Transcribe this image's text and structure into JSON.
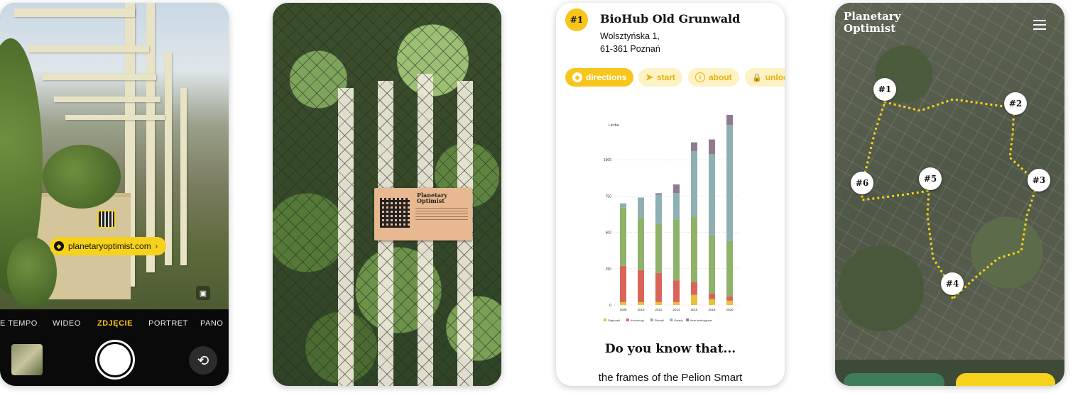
{
  "camera": {
    "modes": [
      "TIME-LAPSE TEMPO",
      "WIDEO",
      "ZDJĘCIE",
      "PORTRET",
      "PANORAMA"
    ],
    "modes_visible": [
      "E TEMPO",
      "WIDEO",
      "ZDJĘCIE",
      "PORTRET",
      "PANO"
    ],
    "active_mode": "ZDJĘCIE",
    "link_chip": "planetaryoptimist.com",
    "accent": "#f7c51c"
  },
  "sign": {
    "logo_line1": "Planetary",
    "logo_line2": "Optimist"
  },
  "detail": {
    "badge": "#1",
    "title": "BioHub Old Grunwald",
    "address_line1": "Wolsztyńska 1,",
    "address_line2": "61-361 Poznań",
    "actions": [
      {
        "label": "directions",
        "icon": "diamond-arrow-icon"
      },
      {
        "label": "start",
        "icon": "navigation-arrow-icon"
      },
      {
        "label": "about",
        "icon": "info-icon"
      },
      {
        "label": "unlock",
        "icon": "lock-icon"
      }
    ],
    "section_title": "Do you know that...",
    "body_text": "the frames of the Pelion Smart"
  },
  "chart_data": {
    "type": "bar",
    "stacked": true,
    "ylabel": "Liczba",
    "ylim": [
      0,
      1250
    ],
    "yticks": [
      0,
      250,
      500,
      750,
      1000
    ],
    "categories": [
      "2008",
      "2010",
      "2012",
      "2014",
      "2016",
      "2018",
      "2020"
    ],
    "series": [
      {
        "name": "Pajęczaki",
        "color": "#e6c13a",
        "values": [
          20,
          20,
          20,
          20,
          70,
          40,
          30
        ]
      },
      {
        "name": "Krocionogi",
        "color": "#d9655a",
        "values": [
          250,
          220,
          200,
          150,
          90,
          40,
          30
        ]
      },
      {
        "name": "Ślimaki",
        "color": "#8fb26a",
        "values": [
          400,
          360,
          340,
          420,
          450,
          400,
          380
        ]
      },
      {
        "name": "Owady",
        "color": "#8fb0b2",
        "values": [
          30,
          140,
          200,
          180,
          450,
          560,
          800
        ]
      },
      {
        "name": "Inne bezkręgowe",
        "color": "#8e7b8e",
        "values": [
          0,
          0,
          10,
          60,
          60,
          100,
          100
        ]
      }
    ]
  },
  "map": {
    "brand_line1": "Planetary",
    "brand_line2": "Optimist",
    "pins": [
      "#1",
      "#2",
      "#3",
      "#4",
      "#5",
      "#6"
    ]
  }
}
